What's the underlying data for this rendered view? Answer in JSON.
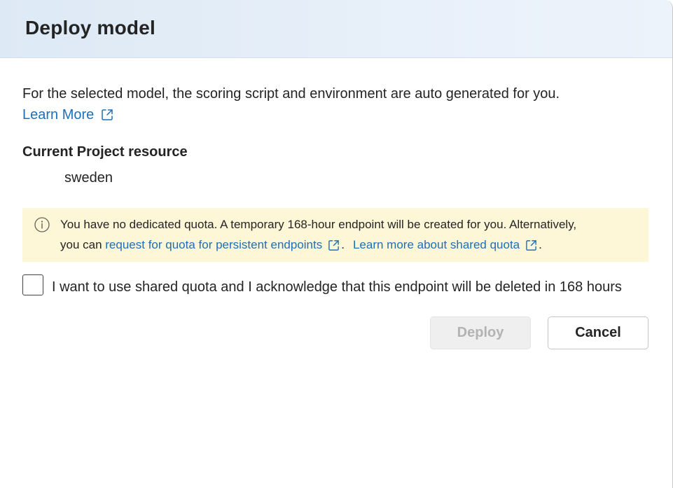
{
  "dialog": {
    "title": "Deploy model",
    "description": "For the selected model, the scoring script and environment are auto generated for you.",
    "learn_more_label": "Learn More",
    "resource_label": "Current Project resource",
    "resource_value": "sweden"
  },
  "warning": {
    "line1": "You have no dedicated quota. A temporary 168-hour endpoint will be created for you. Alternatively,",
    "line2_prefix": "you can ",
    "quota_link": "request for quota for persistent endpoints",
    "separator": ".",
    "shared_link": "Learn more about shared quota",
    "suffix": "."
  },
  "acknowledge": {
    "label": "I want to use shared quota and I acknowledge that this endpoint will be deleted in 168 hours",
    "checked": false
  },
  "buttons": {
    "deploy": "Deploy",
    "cancel": "Cancel"
  },
  "icons": {
    "external_link": "external-link-icon",
    "info": "info-icon"
  },
  "colors": {
    "link": "#1e6fb8",
    "warning_bg": "#fdf6d7",
    "header_bg": "#dde9f5",
    "disabled_text": "#b3b3b3"
  }
}
